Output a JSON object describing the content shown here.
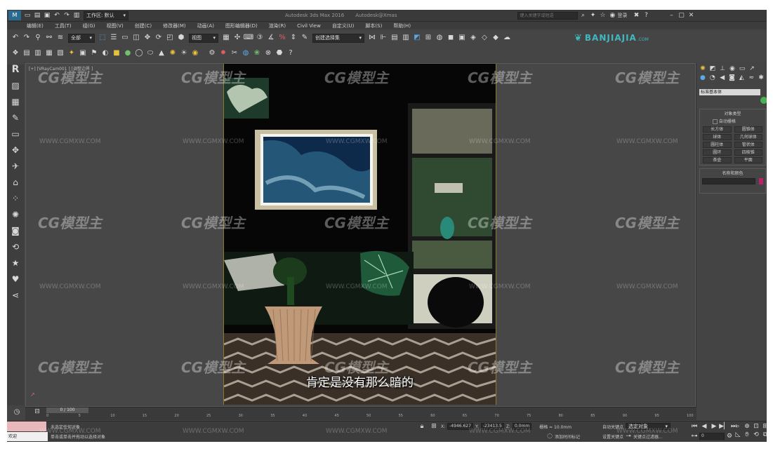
{
  "titlebar": {
    "workspace": "工作区: 默认",
    "app_title": "Autodesk 3ds Max 2016",
    "file_title": "Autodesk@Xmas",
    "search_placeholder": "键入关键字或短语",
    "user": "登录"
  },
  "menubar": [
    "编辑(E)",
    "工具(T)",
    "组(G)",
    "视图(V)",
    "创建(C)",
    "修改器(M)",
    "动画(A)",
    "图形编辑器(D)",
    "渲染(R)",
    "Civil View",
    "自定义(U)",
    "脚本(S)",
    "帮助(H)"
  ],
  "toolbar1": {
    "selection_filter": "全部",
    "reference_coord": "视图",
    "named_selection": "创建选择集"
  },
  "brand": {
    "name": "BANJIAJIA",
    "suffix": ".COM",
    "color": "#3fb8c0"
  },
  "viewport": {
    "label": "[+] [VRayCam001 ] [调整边界 ]",
    "subtitle": "肯定是没有那么暗的"
  },
  "command_panel": {
    "category": "标准基本体",
    "object_type_title": "对象类型",
    "autogrid": "自动栅格",
    "buttons": [
      "长方体",
      "圆锥体",
      "球体",
      "几何球体",
      "圆柱体",
      "管状体",
      "圆环",
      "四棱锥",
      "茶壶",
      "平面"
    ],
    "name_color_title": "名称和颜色",
    "swatch_color": "#c0206a"
  },
  "timeline": {
    "slider": "0 / 100",
    "ticks": [
      0,
      5,
      10,
      15,
      20,
      25,
      30,
      35,
      40,
      45,
      50,
      55,
      60,
      65,
      70,
      75,
      80,
      85,
      90,
      95,
      100
    ]
  },
  "status": {
    "line1": "未选定任何对象",
    "line2": "单击或单击并拖动以选择对象",
    "maxscript_label": "欢迎",
    "x": "-4946.627",
    "y": "-23413.5",
    "z": "0.0mm",
    "grid": "栅格 = 10.0mm",
    "autokey": "自动关键点",
    "selected_dropdown": "选定对象",
    "setkey": "设置关键点",
    "key_filters": "关键点过滤器...",
    "add_time_tag": "添加时间标记",
    "frame": "0"
  },
  "watermarks": {
    "logo": "CG模型主",
    "url": "WWW.CGMXW.COM"
  }
}
